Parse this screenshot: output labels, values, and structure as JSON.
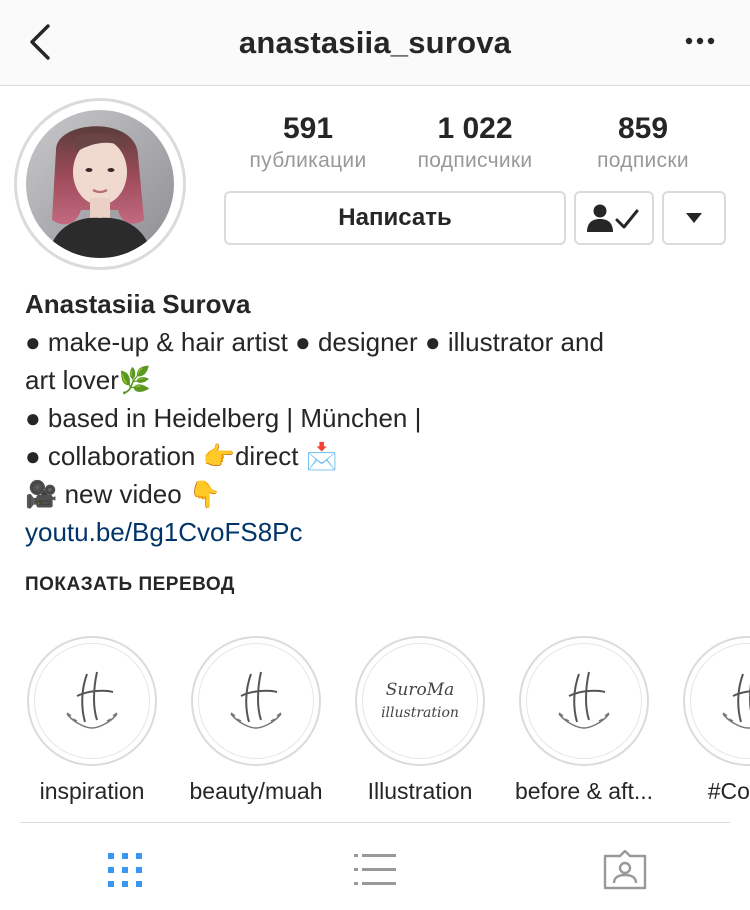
{
  "header": {
    "username": "anastasiia_surova",
    "back_icon": "chevron-left-icon",
    "more_icon": "more-horizontal-icon"
  },
  "stats": {
    "posts": {
      "value": "591",
      "label": "публикации"
    },
    "followers": {
      "value": "1 022",
      "label": "подписчики"
    },
    "following": {
      "value": "859",
      "label": "подписки"
    }
  },
  "actions": {
    "message_label": "Написать",
    "following_icon": "person-check-icon",
    "suggest_icon": "triangle-down-icon"
  },
  "bio": {
    "name": "Anastasiia Surova",
    "line1": "● make-up & hair artist ● designer ● illustrator and",
    "line2": "art lover🌿",
    "line3": "● based in Heidelberg | München |",
    "line4": "● collaboration 👉direct 📩",
    "line5": "🎥 new video 👇",
    "link": "youtu.be/Bg1CvoFS8Pc"
  },
  "translate_label": "ПОКАЗАТЬ ПЕРЕВОД",
  "highlights": [
    {
      "label": "inspiration",
      "logo_text": ""
    },
    {
      "label": "beauty/muah",
      "logo_text": ""
    },
    {
      "label": "Illustration",
      "logo_text_1": "SuroMa",
      "logo_text_2": "illustration"
    },
    {
      "label": "before & aft...",
      "logo_text": ""
    },
    {
      "label": "#Colore",
      "logo_text": ""
    }
  ],
  "tabs": [
    {
      "icon": "grid-icon",
      "active": true
    },
    {
      "icon": "list-icon",
      "active": false
    },
    {
      "icon": "tagged-person-icon",
      "active": false
    }
  ],
  "colors": {
    "active_tab": "#3897f0",
    "inactive_tab": "#999999",
    "link": "#003569",
    "border": "#dbdbdb"
  }
}
